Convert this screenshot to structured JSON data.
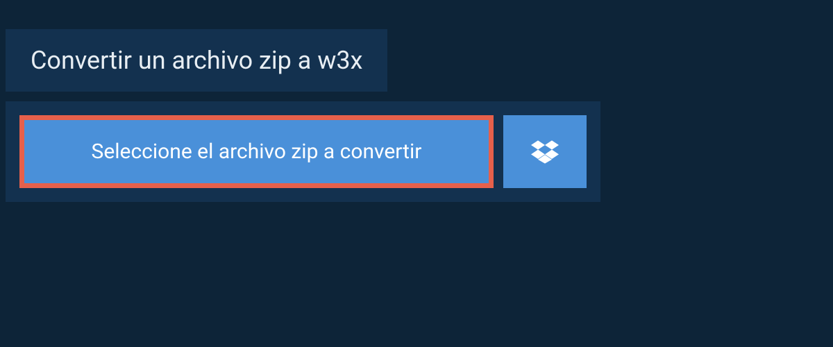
{
  "header": {
    "title": "Convertir un archivo zip a w3x"
  },
  "upload": {
    "select_button_label": "Seleccione el archivo zip a convertir",
    "dropbox_icon_name": "dropbox-icon"
  }
}
